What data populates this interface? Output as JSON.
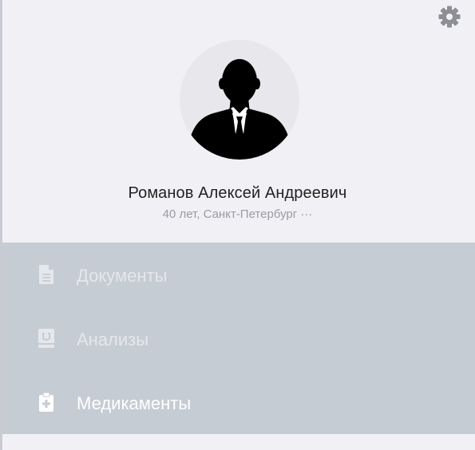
{
  "header": {
    "settings_icon": "gear-icon"
  },
  "profile": {
    "avatar_icon": "person-silhouette-icon",
    "name": "Романов Алексей Андреевич",
    "meta": "40 лет, Санкт-Петербург ···"
  },
  "menu": {
    "items": [
      {
        "label": "Документы",
        "icon": "document-icon",
        "active": false
      },
      {
        "label": "Анализы",
        "icon": "lab-tests-icon",
        "active": false
      },
      {
        "label": "Медикаменты",
        "icon": "medical-clipboard-icon",
        "active": true
      }
    ]
  },
  "colors": {
    "background": "#f1f1f5",
    "menu_background": "#c6ccd4",
    "active_text": "#ffffff",
    "inactive_text": "#e4e7ec",
    "gear": "#8d8f94"
  }
}
